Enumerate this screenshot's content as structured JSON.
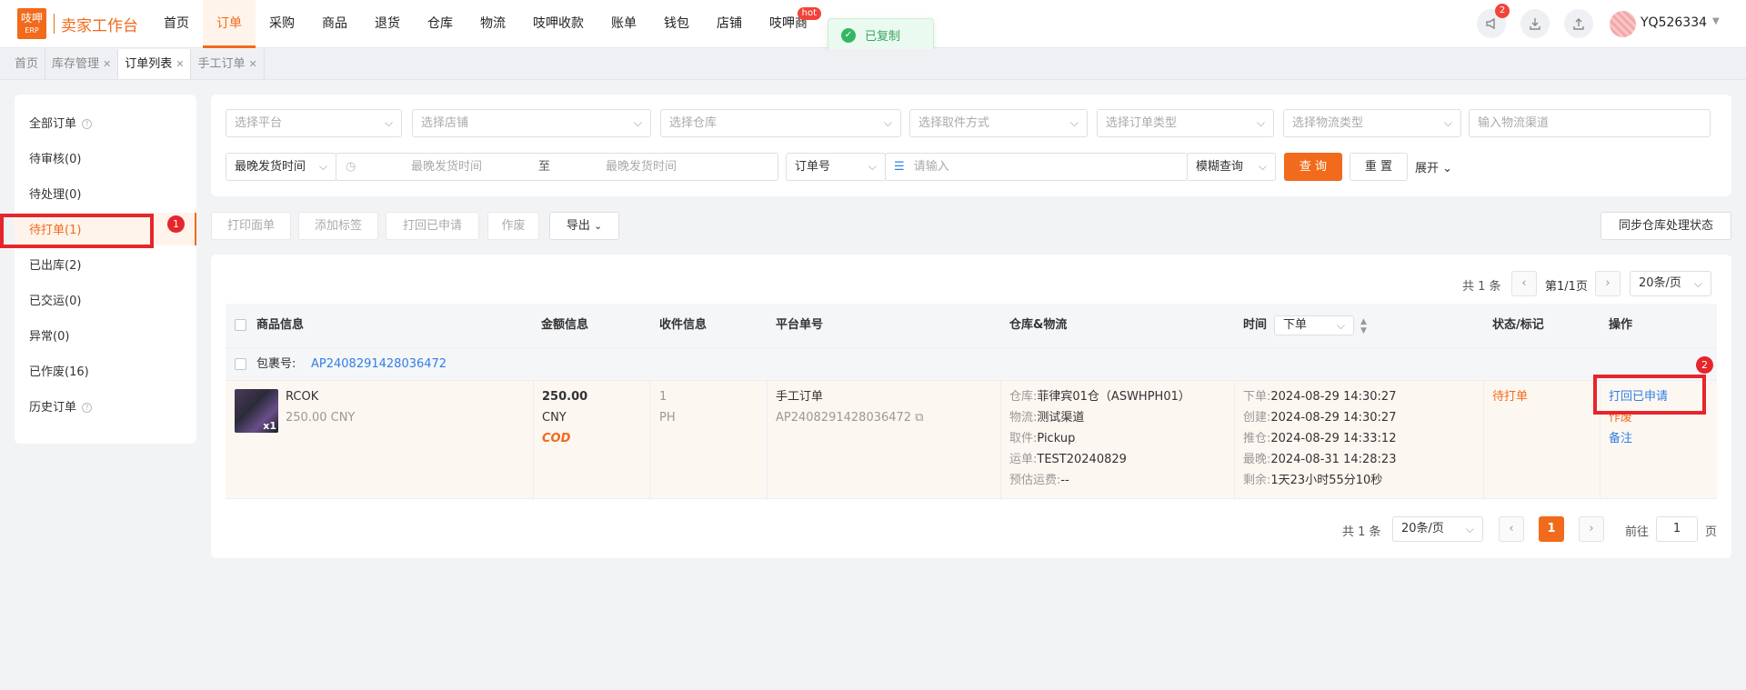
{
  "app": {
    "logo_top": "吱呷",
    "logo_bottom": "ERP",
    "brand": "卖家工作台"
  },
  "nav": [
    "首页",
    "订单",
    "采购",
    "商品",
    "退货",
    "仓库",
    "物流",
    "吱呷收款",
    "账单",
    "钱包",
    "店铺",
    "吱呷商"
  ],
  "nav_hot_badge": "hot",
  "toast": "已复制",
  "header": {
    "notify_count": "2",
    "username": "YQ526334"
  },
  "page_tabs": [
    "首页",
    "库存管理",
    "订单列表",
    "手工订单"
  ],
  "sidebar": [
    {
      "label": "全部订单",
      "help": true
    },
    {
      "label": "待审核(0)"
    },
    {
      "label": "待处理(0)"
    },
    {
      "label": "待打单(1)"
    },
    {
      "label": "已出库(2)"
    },
    {
      "label": "已交运(0)"
    },
    {
      "label": "异常(0)"
    },
    {
      "label": "已作废(16)"
    },
    {
      "label": "历史订单",
      "help": true
    }
  ],
  "annotations": {
    "step1": "1",
    "step2": "2"
  },
  "filters": {
    "platform": "选择平台",
    "shop": "选择店铺",
    "warehouse": "选择仓库",
    "pickup": "选择取件方式",
    "order_type": "选择订单类型",
    "logistics_type": "选择物流类型",
    "channel_placeholder": "输入物流渠道",
    "time_type": "最晚发货时间",
    "start_placeholder": "最晚发货时间",
    "to": "至",
    "end_placeholder": "最晚发货时间",
    "field": "订单号",
    "keyword_placeholder": "请输入",
    "match": "模糊查询",
    "query": "查 询",
    "reset": "重 置",
    "expand": "展开"
  },
  "actions": {
    "print": "打印面单",
    "tag": "添加标签",
    "recall": "打回已申请",
    "void": "作废",
    "export": "导出",
    "sync": "同步仓库处理状态"
  },
  "pager": {
    "total": "共 1 条",
    "page_info": "第1/1页",
    "page_size": "20条/页",
    "current": "1",
    "goto": "前往",
    "goto_value": "1",
    "page_unit": "页"
  },
  "table": {
    "headers": {
      "product": "商品信息",
      "amount": "金额信息",
      "receiver": "收件信息",
      "platform_no": "平台单号",
      "wh": "仓库&物流",
      "time": "时间",
      "time_sort": "下单",
      "status": "状态/标记",
      "ops": "操作"
    },
    "package_label": "包裹号:",
    "package_no": "AP2408291428036472",
    "row": {
      "name": "RCOK",
      "price": "250.00 CNY",
      "qty": "x1",
      "amount": "250.00",
      "currency": "CNY",
      "pay": "COD",
      "recv_qty": "1",
      "recv_country": "PH",
      "order_type": "手工订单",
      "platform_order_no": "AP2408291428036472",
      "wh_lines": [
        {
          "k": "仓库:",
          "v": "菲律宾01仓（ASWHPH01）"
        },
        {
          "k": "物流:",
          "v": "测试渠道"
        },
        {
          "k": "取件:",
          "v": "Pickup"
        },
        {
          "k": "运单:",
          "v": "TEST20240829"
        },
        {
          "k": "预估运费:",
          "v": "--"
        }
      ],
      "time_lines": [
        {
          "k": "下单:",
          "v": "2024-08-29 14:30:27"
        },
        {
          "k": "创建:",
          "v": "2024-08-29 14:30:27"
        },
        {
          "k": "推仓:",
          "v": "2024-08-29 14:33:12"
        },
        {
          "k": "最晚:",
          "v": "2024-08-31 14:28:23"
        },
        {
          "k": "剩余:",
          "v": "1天23小时55分10秒"
        }
      ],
      "status": "待打单",
      "ops": [
        "打回已申请",
        "作废",
        "备注"
      ]
    }
  },
  "colors": {
    "accent": "#f26a1b",
    "annotation": "#e5262b",
    "link": "#2f7fe6"
  }
}
